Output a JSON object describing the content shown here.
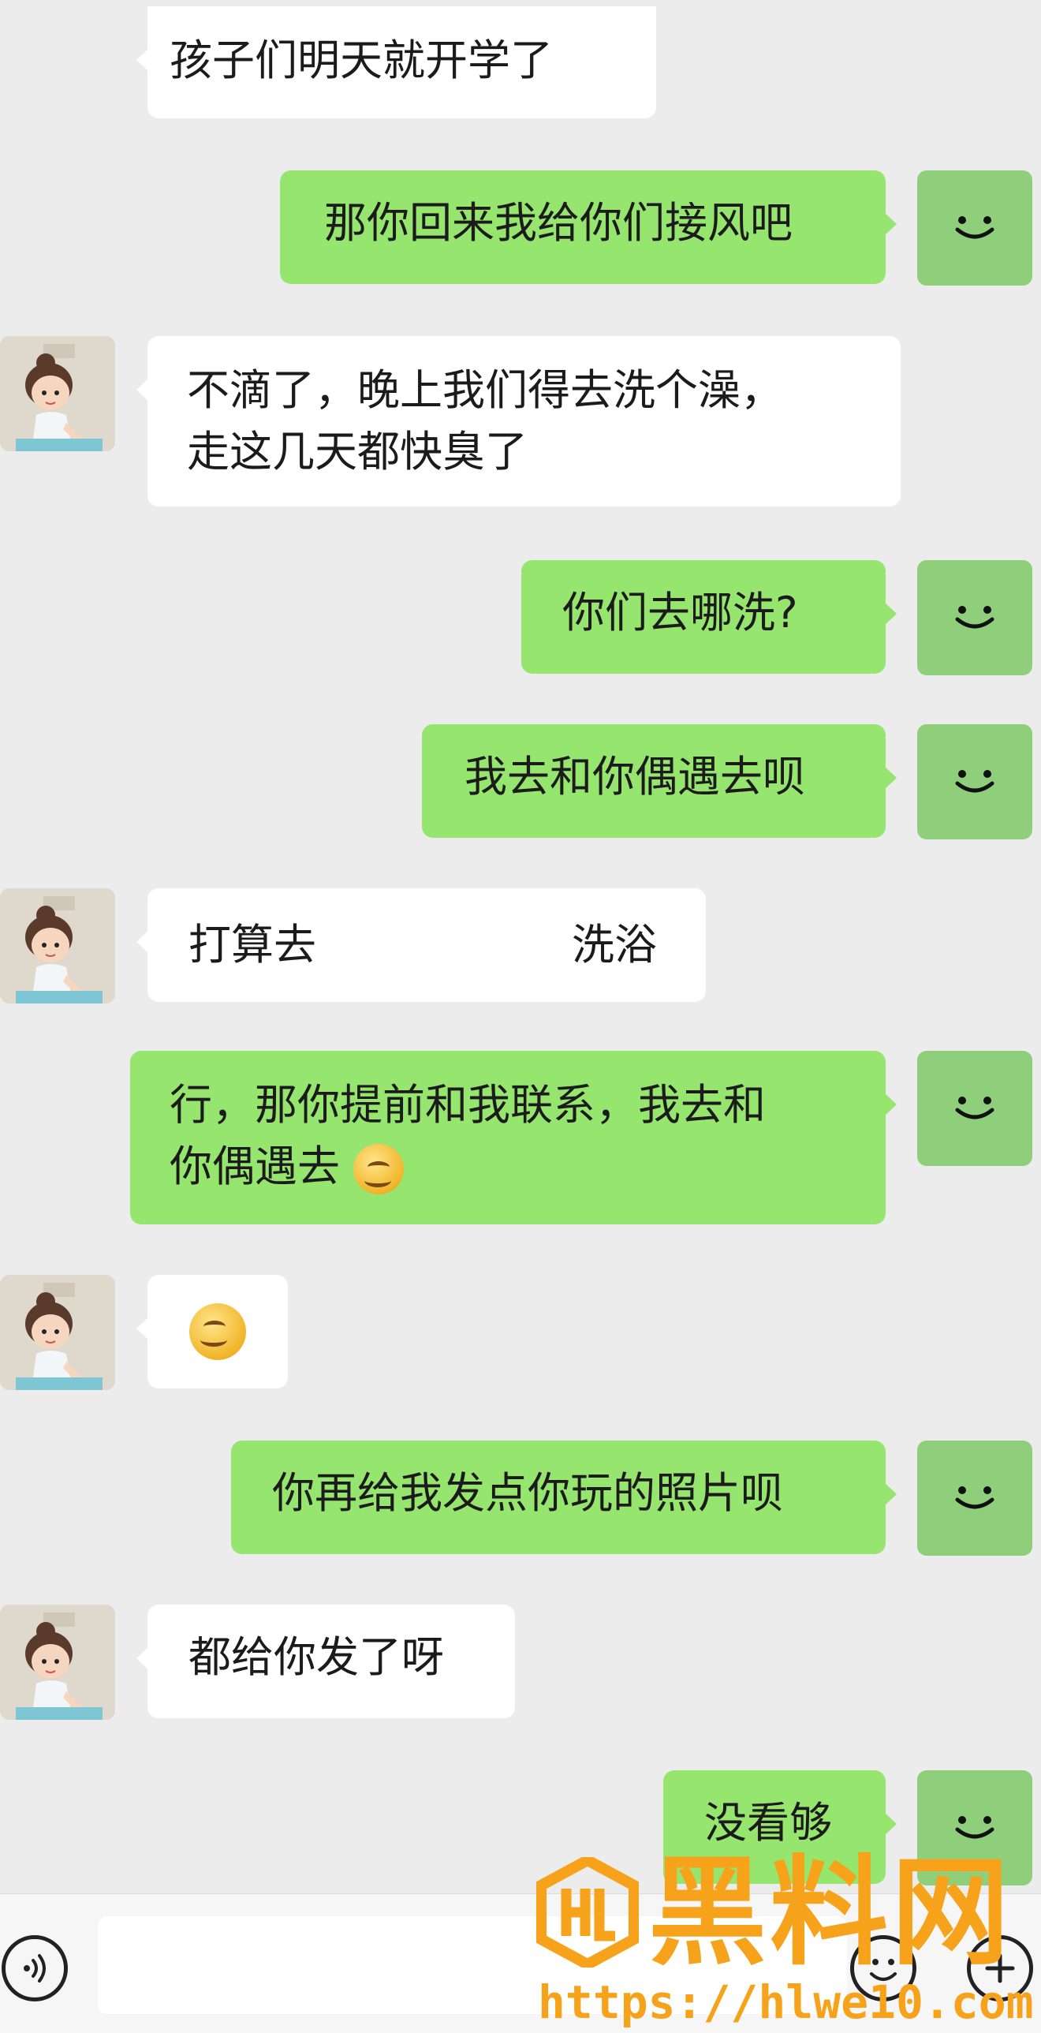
{
  "chat": {
    "messages": [
      {
        "side": "left",
        "lines": [
          "孩子们明天就开学了"
        ],
        "partial_top": true
      },
      {
        "side": "right",
        "lines": [
          "那你回来我给你们接风吧"
        ]
      },
      {
        "side": "left",
        "lines": [
          "不滴了，晚上我们得去洗个澡，",
          "走这几天都快臭了"
        ]
      },
      {
        "side": "right",
        "lines": [
          "你们去哪洗?"
        ]
      },
      {
        "side": "right",
        "lines": [
          "我去和你偶遇去呗"
        ]
      },
      {
        "side": "left",
        "lines": [
          "打算去",
          "洗浴"
        ]
      },
      {
        "side": "right",
        "lines": [
          "行，那你提前和我联系，我去和",
          "你偶遇去"
        ],
        "emoji": "smirk-emoji"
      },
      {
        "side": "left",
        "lines": [],
        "emoji": "smirk-emoji"
      },
      {
        "side": "right",
        "lines": [
          "你再给我发点你玩的照片呗"
        ]
      },
      {
        "side": "left",
        "lines": [
          "都给你发了呀"
        ]
      },
      {
        "side": "right",
        "lines": [
          "没看够"
        ]
      }
    ],
    "m0": "孩子们明天就开学了",
    "m1": "那你回来我给你们接风吧",
    "m2a": "不滴了，晚上我们得去洗个澡，",
    "m2b": "走这几天都快臭了",
    "m3": "你们去哪洗?",
    "m4": "我去和你偶遇去呗",
    "m5a": "打算去",
    "m5b": "洗浴",
    "m6a": "行，那你提前和我联系，我去和",
    "m6b": "你偶遇去",
    "m8": "你再给我发点你玩的照片呗",
    "m9": "都给你发了呀",
    "m10": "没看够"
  },
  "input_bar": {
    "voice_icon": "voice-icon",
    "emoji_icon": "emoji-icon",
    "plus_icon": "plus-icon",
    "input_value": ""
  },
  "watermark": {
    "title": "黑料网",
    "url": "https://hlwe10.com"
  },
  "colors": {
    "background": "#ececec",
    "sent_bubble": "#95e56f",
    "received_bubble": "#ffffff",
    "watermark": "#f7a21b"
  }
}
